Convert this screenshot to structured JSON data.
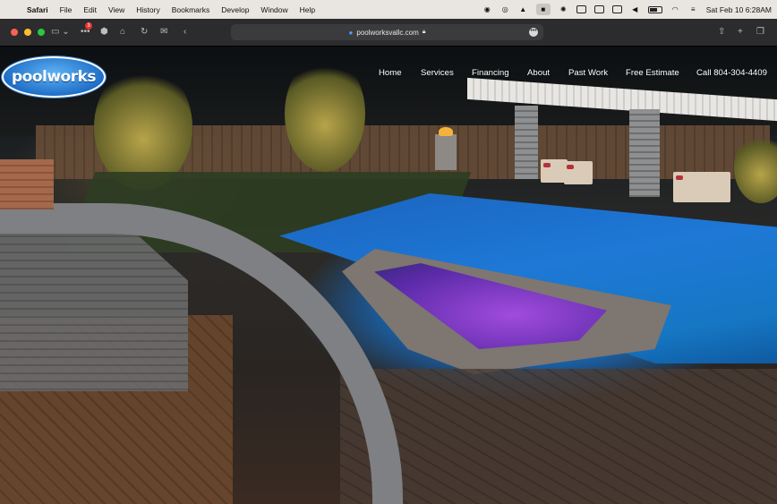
{
  "menubar": {
    "app": "Safari",
    "items": [
      "File",
      "Edit",
      "View",
      "History",
      "Bookmarks",
      "Develop",
      "Window",
      "Help"
    ],
    "clock": "Sat Feb 10  6:28AM"
  },
  "toolbar": {
    "badge_count": "3",
    "url": "poolworksvallc.com",
    "traffic_colors": [
      "#fe5f57",
      "#febc2e",
      "#28c840"
    ]
  },
  "site": {
    "logo_text": "poolworks",
    "nav": [
      "Home",
      "Services",
      "Financing",
      "About",
      "Past Work",
      "Free Estimate",
      "Call 804-304-4409"
    ]
  }
}
